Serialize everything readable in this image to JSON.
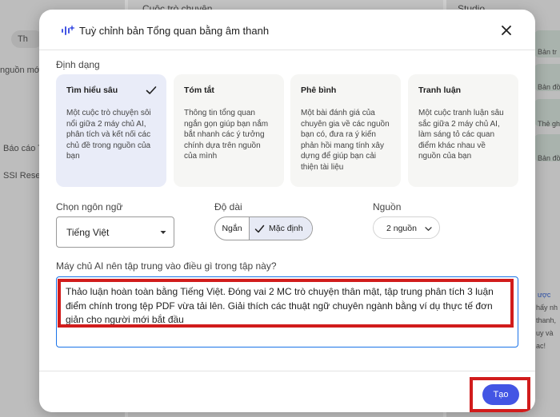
{
  "background": {
    "left_tab": "Th",
    "left_text_1": "nguồn mới",
    "left_item_1": "Báo cáo T",
    "left_item_2": "SSI Resear",
    "middle_title": "Cuộc trò chuyện",
    "right_title": "Studio",
    "right_item_1": "Bản tr",
    "right_item_2": "Bản đồ",
    "right_item_3": "Thẻ gh",
    "right_item_4": "Bản đồ",
    "right_snippets": [
      "ược",
      "hấy nh",
      "thanh,",
      "uy và",
      "ac!"
    ]
  },
  "dialog": {
    "title": "Tuỳ chỉnh bản Tổng quan bằng âm thanh",
    "format_label": "Định dạng",
    "formats": [
      {
        "title": "Tìm hiểu sâu",
        "desc": "Một cuộc trò chuyện sôi nổi giữa 2 máy chủ AI, phân tích và kết nối các chủ đề trong nguồn của bạn",
        "selected": true
      },
      {
        "title": "Tóm tắt",
        "desc": "Thông tin tổng quan ngắn gọn giúp bạn nắm bắt nhanh các ý tưởng chính dựa trên nguồn của mình",
        "selected": false
      },
      {
        "title": "Phê bình",
        "desc": "Một bài đánh giá của chuyên gia về các nguồn bạn có, đưa ra ý kiến phản hồi mang tính xây dựng để giúp bạn cải thiện tài liệu",
        "selected": false
      },
      {
        "title": "Tranh luận",
        "desc": "Một cuộc tranh luận sâu sắc giữa 2 máy chủ AI, làm sáng tỏ các quan điểm khác nhau về nguồn của bạn",
        "selected": false
      }
    ],
    "language_label": "Chọn ngôn ngữ",
    "language_value": "Tiếng Việt",
    "length_label": "Độ dài",
    "length_short": "Ngắn",
    "length_default": "Mặc định",
    "length_selected": "Mặc định",
    "sources_label": "Nguồn",
    "sources_value": "2 nguồn",
    "focus_label": "Máy chủ AI nên tập trung vào điều gì trong tập này?",
    "focus_text": "Thảo luận hoàn toàn bằng Tiếng Việt. Đóng vai 2 MC trò chuyện thân mật, tập trung phân tích 3 luận điểm chính trong tệp PDF vừa tải lên. Giải thích các thuật ngữ chuyên ngành bằng ví dụ thực tế đơn giản cho người mới bắt đầu",
    "create_label": "Tạo"
  },
  "colors": {
    "accent": "#4355e4",
    "selected_card": "#e9ecf8",
    "highlight": "#d11c1c",
    "focus_border": "#1a73e8"
  }
}
